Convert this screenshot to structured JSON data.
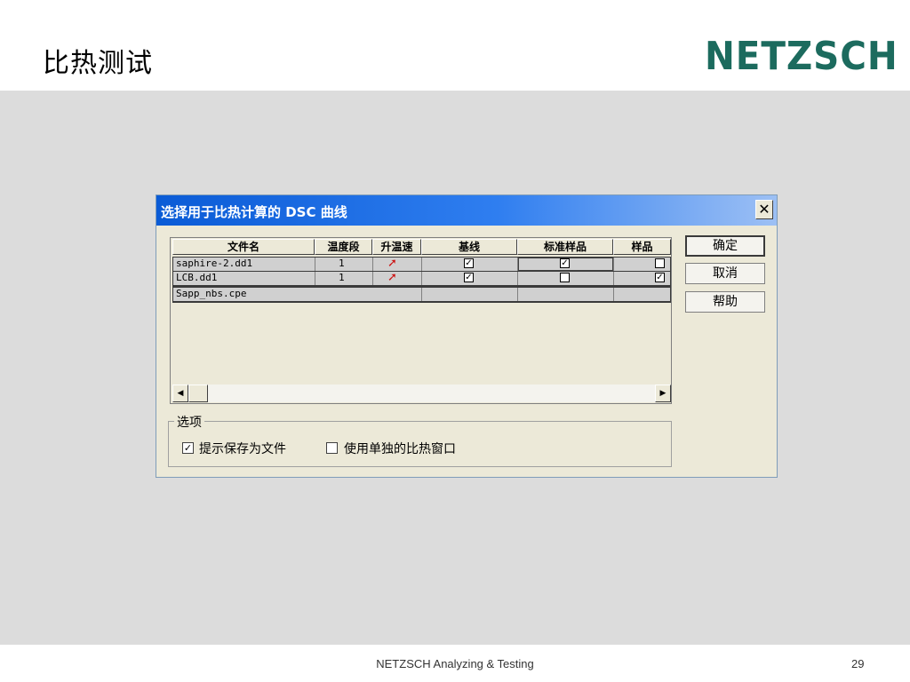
{
  "slide": {
    "title": "比热测试",
    "logo_text": "NETZSCH",
    "footer": "NETZSCH Analyzing & Testing",
    "page_number": "29",
    "accent_color": "#1c6b5e"
  },
  "dialog": {
    "title": "选择用于比热计算的 DSC 曲线",
    "close_glyph": "✕",
    "columns": [
      "文件名",
      "温度段",
      "升温速",
      "基线",
      "标准样品",
      "样品"
    ],
    "rows": [
      {
        "filename": "saphire-2.dd1",
        "segment": "1",
        "heating_icon": "red-arrow-icon",
        "baseline": true,
        "standard": true,
        "sample": false
      },
      {
        "filename": "LCB.dd1",
        "segment": "1",
        "heating_icon": "red-arrow-icon",
        "baseline": true,
        "standard": false,
        "sample": true
      },
      {
        "filename": "Sapp_nbs.cpe",
        "segment": "",
        "heating_icon": "",
        "baseline": null,
        "standard": null,
        "sample": null
      }
    ],
    "scroll_left": "◀",
    "scroll_right": "▶",
    "buttons": {
      "ok": "确定",
      "cancel": "取消",
      "help": "帮助"
    },
    "options": {
      "label": "选项",
      "save_file": {
        "label": "提示保存为文件",
        "checked": true
      },
      "separate_window": {
        "label": "使用单独的比热窗口",
        "checked": false
      }
    },
    "check_glyph": "✓",
    "arrow_glyph": "➚"
  }
}
